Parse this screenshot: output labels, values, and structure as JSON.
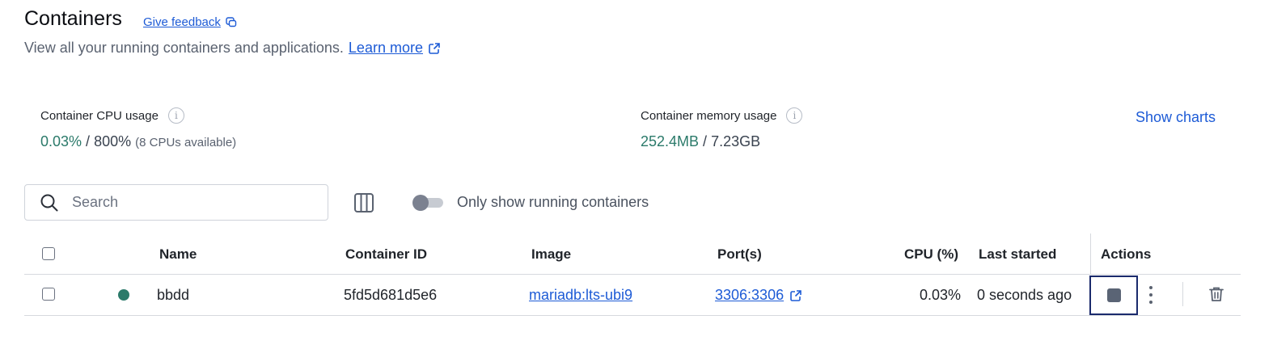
{
  "header": {
    "title": "Containers",
    "feedback_label": "Give feedback",
    "subtitle": "View all your running containers and applications.",
    "learn_more": "Learn more"
  },
  "metrics": {
    "cpu": {
      "label": "Container CPU usage",
      "used": "0.03%",
      "separator": " / ",
      "total": "800%",
      "note": "(8 CPUs available)"
    },
    "memory": {
      "label": "Container memory usage",
      "used": "252.4MB",
      "separator": " / ",
      "total": "7.23GB"
    },
    "show_charts": "Show charts"
  },
  "toolbar": {
    "search_placeholder": "Search",
    "toggle_label": "Only show running containers",
    "toggle_on": false
  },
  "table": {
    "headers": {
      "name": "Name",
      "container_id": "Container ID",
      "image": "Image",
      "ports": "Port(s)",
      "cpu": "CPU (%)",
      "last_started": "Last started",
      "actions": "Actions"
    },
    "rows": [
      {
        "status": "running",
        "name": "bbdd",
        "container_id": "5fd5d681d5e6",
        "image": "mariadb:lts-ubi9",
        "ports": "3306:3306",
        "cpu": "0.03%",
        "last_started": "0 seconds ago"
      }
    ]
  },
  "colors": {
    "link": "#1d5bd6",
    "running": "#2b7a6a",
    "stop_focus": "#1a2a6c"
  }
}
